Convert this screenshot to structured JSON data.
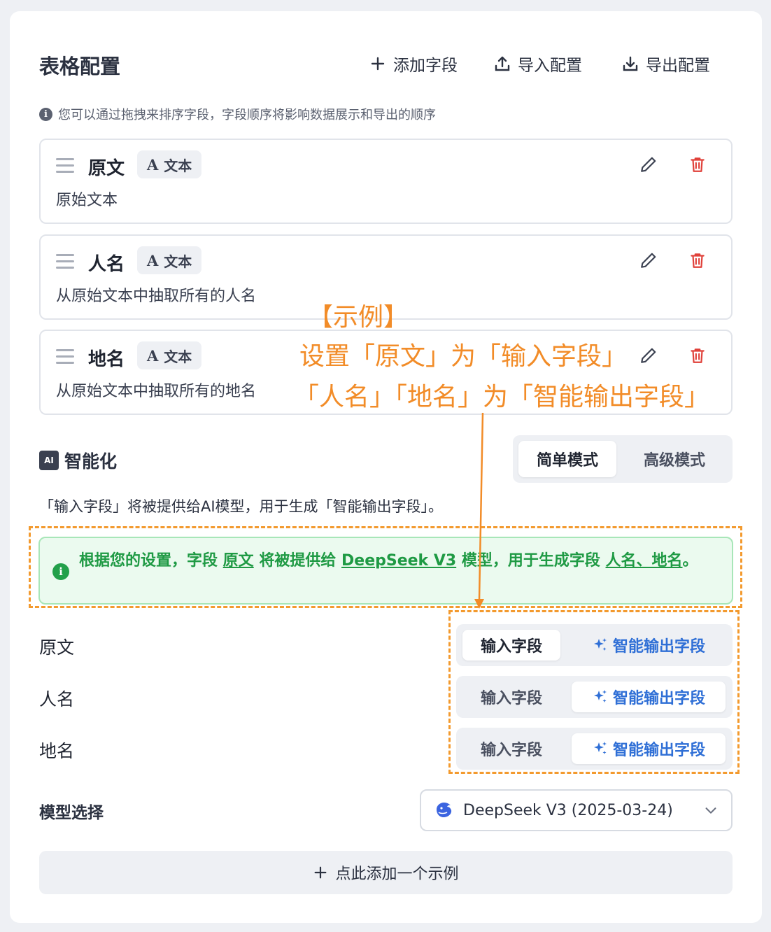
{
  "header": {
    "title": "表格配置",
    "add_field": "添加字段",
    "import": "导入配置",
    "export": "导出配置"
  },
  "hint": "您可以通过拖拽来排序字段，字段顺序将影响数据展示和导出的顺序",
  "fields": [
    {
      "name": "原文",
      "type_icon": "A",
      "type": "文本",
      "desc": "原始文本"
    },
    {
      "name": "人名",
      "type_icon": "A",
      "type": "文本",
      "desc": "从原始文本中抽取所有的人名"
    },
    {
      "name": "地名",
      "type_icon": "A",
      "type": "文本",
      "desc": "从原始文本中抽取所有的地名"
    }
  ],
  "ai": {
    "title": "智能化",
    "chip": "AI",
    "mode_simple": "简单模式",
    "mode_advanced": "高级模式",
    "desc": "「输入字段」将被提供给AI模型，用于生成「智能输出字段」。",
    "alert": {
      "p1": "根据您的设置，字段 ",
      "input_field": "原文",
      "p2": " 将被提供给 ",
      "model": "DeepSeek V3",
      "p3": " 模型，用于生成字段 ",
      "output_fields": "人名、地名",
      "p4": "。"
    },
    "rows": [
      {
        "label": "原文",
        "input": "输入字段",
        "output": "智能输出字段",
        "selected": "input"
      },
      {
        "label": "人名",
        "input": "输入字段",
        "output": "智能输出字段",
        "selected": "output"
      },
      {
        "label": "地名",
        "input": "输入字段",
        "output": "智能输出字段",
        "selected": "output"
      }
    ]
  },
  "model": {
    "label": "模型选择",
    "value": "DeepSeek V3 (2025-03-24)"
  },
  "add_example": "点此添加一个示例",
  "annotation": {
    "line1": "【示例】",
    "line2": "设置「原文」为「输入字段」",
    "line3": "「人名」「地名」为「智能输出字段」"
  },
  "colors": {
    "accent_blue": "#2f6fd6",
    "success_green": "#1f9a44",
    "danger_red": "#e0413a",
    "annotation_orange": "#f28c28"
  }
}
